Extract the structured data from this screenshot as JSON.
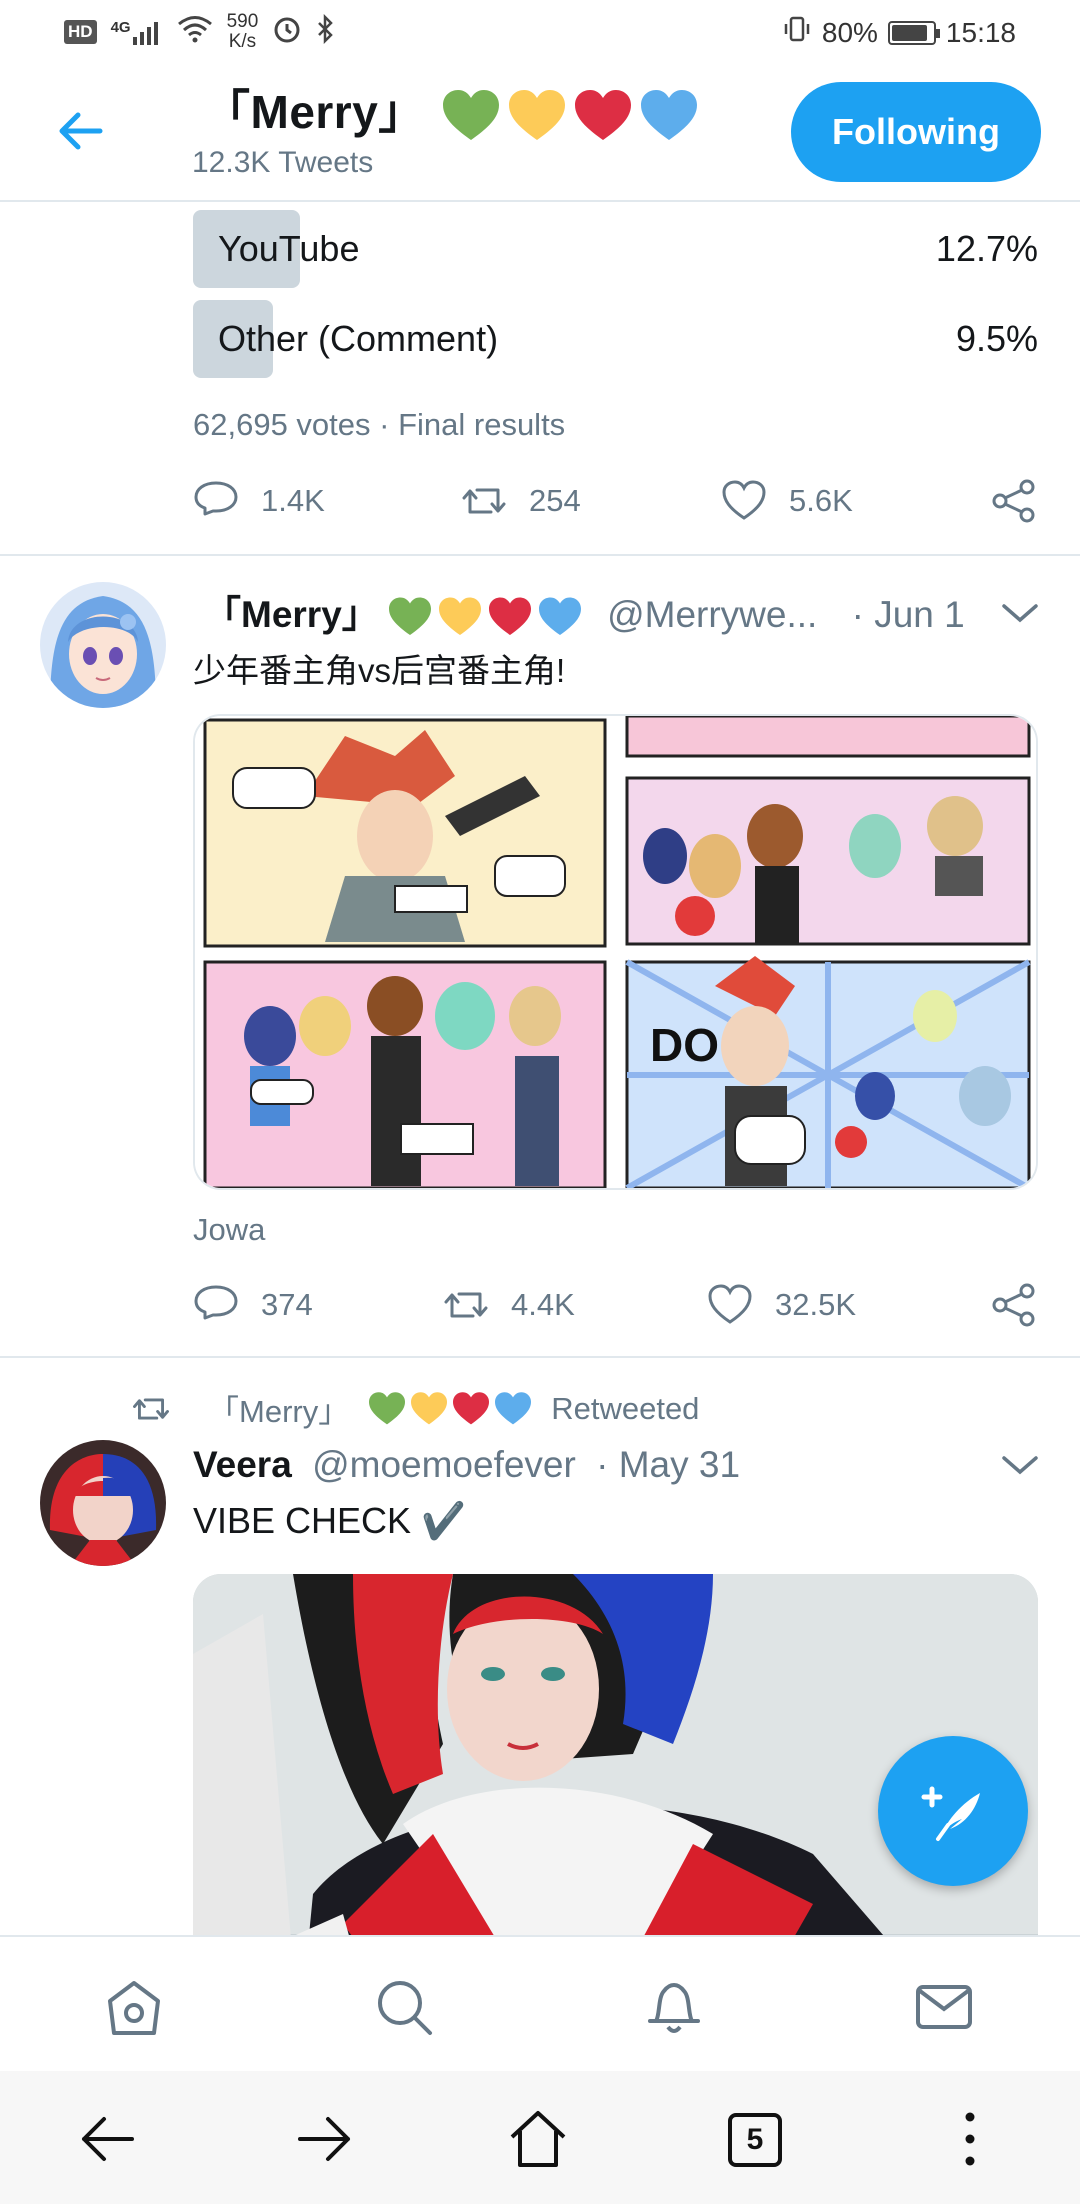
{
  "status_bar": {
    "hd": "HD",
    "network": "4G",
    "speed_value": "590",
    "speed_unit": "K/s",
    "battery": "80%",
    "battery_level": 0.8,
    "time": "15:18"
  },
  "header": {
    "name": "「Merry」",
    "tweets": "12.3K Tweets",
    "follow_button": "Following",
    "heart_colors": [
      "#77b255",
      "#fdcb58",
      "#dd2e44",
      "#5dadec"
    ]
  },
  "poll": {
    "options": [
      {
        "label": "YouTube",
        "percent": "12.7%",
        "fraction": 0.127
      },
      {
        "label": "Other (Comment)",
        "percent": "9.5%",
        "fraction": 0.095
      }
    ],
    "meta": "62,695 votes · Final results",
    "actions": {
      "replies": "1.4K",
      "retweets": "254",
      "likes": "5.6K"
    }
  },
  "tweet1": {
    "name": "「Merry」",
    "handle": "@Merrywe...",
    "date": "· Jun 1",
    "text": "少年番主角vs后宫番主角!",
    "image_source": "Jowa",
    "actions": {
      "replies": "374",
      "retweets": "4.4K",
      "likes": "32.5K"
    }
  },
  "tweet2": {
    "retweeted_by": "「Merry」",
    "retweeted_label": "Retweeted",
    "name": "Veera",
    "handle": "@moemoefever",
    "date": "· May 31",
    "text": "VIBE CHECK ✔️"
  },
  "bottom_nav": {
    "icons": [
      "home-icon",
      "search-icon",
      "notifications-icon",
      "messages-icon"
    ]
  },
  "browser": {
    "tab_count": "5"
  },
  "colors": {
    "accent": "#1da1f2",
    "muted": "#657786"
  }
}
